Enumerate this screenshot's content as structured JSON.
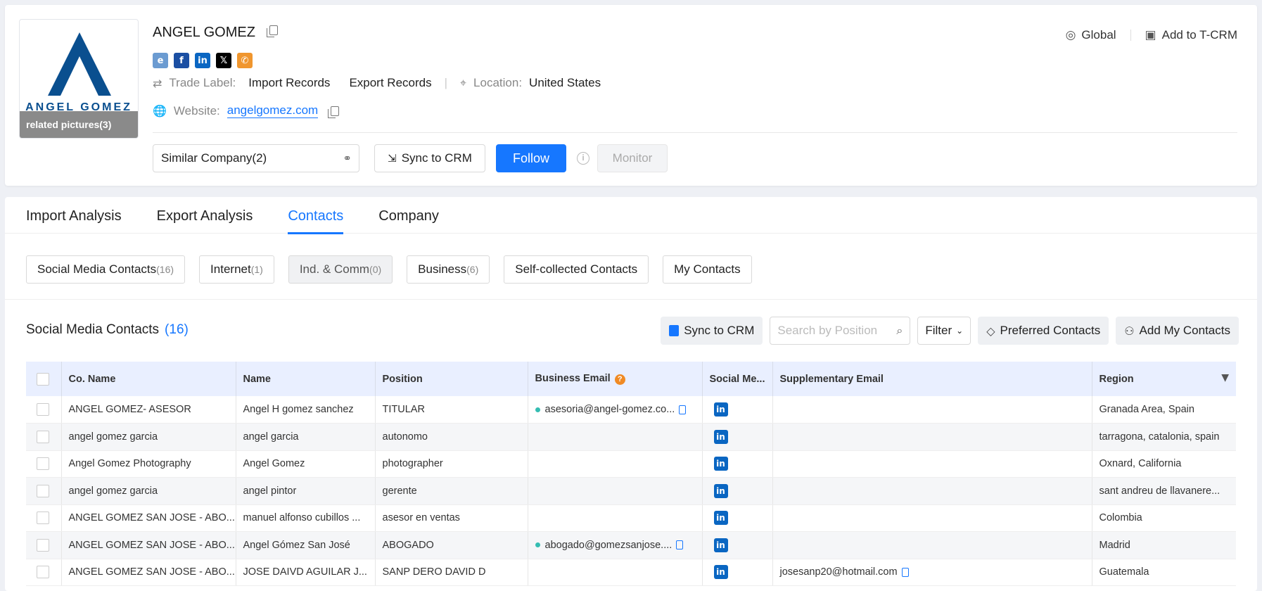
{
  "company": {
    "name": "ANGEL GOMEZ",
    "logo_text": "ANGEL GOMEZ",
    "related_pictures": "related pictures(3)",
    "trade_label": "Trade Label:",
    "trade_values": [
      "Import Records",
      "Export Records"
    ],
    "location_label": "Location:",
    "location_value": "United States",
    "website_label": "Website:",
    "website_value": "angelgomez.com"
  },
  "top_actions": {
    "global": "Global",
    "add_tcrm": "Add to T-CRM",
    "similar_company": "Similar Company(2)",
    "sync_crm": "Sync to CRM",
    "follow": "Follow",
    "monitor": "Monitor"
  },
  "social_icons": [
    "ie-icon",
    "facebook-icon",
    "linkedin-icon",
    "x-icon",
    "phone-icon"
  ],
  "main_tabs": [
    "Import Analysis",
    "Export Analysis",
    "Contacts",
    "Company"
  ],
  "active_tab": "Contacts",
  "sub_tabs": [
    {
      "label": "Social Media Contacts",
      "count": "(16)"
    },
    {
      "label": "Internet",
      "count": "(1)"
    },
    {
      "label": "Ind. & Comm",
      "count": "(0)"
    },
    {
      "label": "Business",
      "count": "(6)"
    },
    {
      "label": "Self-collected Contacts",
      "count": ""
    },
    {
      "label": "My Contacts",
      "count": ""
    }
  ],
  "section": {
    "title": "Social Media Contacts",
    "count": "(16)",
    "sync_crm": "Sync to CRM",
    "search_placeholder": "Search by Position",
    "filter": "Filter",
    "preferred": "Preferred Contacts",
    "add_my": "Add My Contacts"
  },
  "table": {
    "headers": [
      "Co. Name",
      "Name",
      "Position",
      "Business Email",
      "Social Me...",
      "Supplementary Email",
      "Region"
    ],
    "rows": [
      {
        "co": "ANGEL GOMEZ- ASESOR",
        "name": "Angel H gomez sanchez",
        "position": "TITULAR",
        "email": "asesoria@angel-gomez.co...",
        "supp": "",
        "region": "Granada Area, Spain"
      },
      {
        "co": "angel gomez garcia",
        "name": "angel garcia",
        "position": "autonomo",
        "email": "",
        "supp": "",
        "region": "tarragona, catalonia, spain"
      },
      {
        "co": "Angel Gomez Photography",
        "name": "Angel Gomez",
        "position": "photographer",
        "email": "",
        "supp": "",
        "region": "Oxnard, California"
      },
      {
        "co": "angel gomez garcia",
        "name": "angel pintor",
        "position": "gerente",
        "email": "",
        "supp": "",
        "region": "sant andreu de llavanere..."
      },
      {
        "co": "ANGEL GOMEZ SAN JOSE - ABO...",
        "name": "manuel alfonso cubillos ...",
        "position": "asesor en ventas",
        "email": "",
        "supp": "",
        "region": "Colombia"
      },
      {
        "co": "ANGEL GOMEZ SAN JOSE - ABO...",
        "name": "Angel Gómez San José",
        "position": "ABOGADO",
        "email": "abogado@gomezsanjose....",
        "supp": "",
        "region": "Madrid"
      },
      {
        "co": "ANGEL GOMEZ SAN JOSE - ABO...",
        "name": "JOSE DAIVD AGUILAR J...",
        "position": "SANP DERO DAVID D",
        "email": "",
        "supp": "josesanp20@hotmail.com",
        "region": "Guatemala"
      }
    ]
  },
  "colors": {
    "accent": "#1677ff",
    "linkedin": "#0a66c2",
    "header_bg": "#e9efff"
  }
}
